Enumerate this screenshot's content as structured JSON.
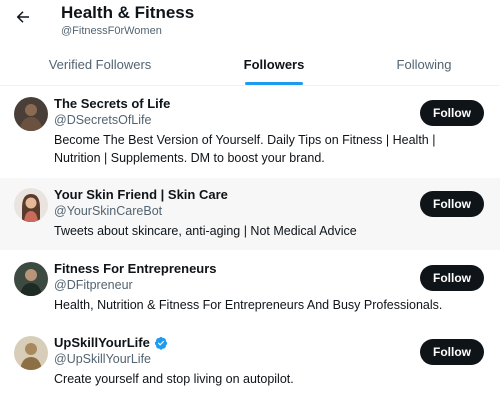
{
  "header": {
    "title": "Health & Fitness",
    "handle": "@FitnessF0rWomen"
  },
  "tabs": [
    {
      "label": "Verified Followers",
      "active": false
    },
    {
      "label": "Followers",
      "active": true
    },
    {
      "label": "Following",
      "active": false
    }
  ],
  "colors": {
    "accent": "#1d9bf0",
    "button_bg": "#0f1419",
    "secondary_text": "#536471"
  },
  "users": [
    {
      "name": "The Secrets of Life",
      "handle": "@DSecretsOfLife",
      "verified": false,
      "bio": "Become The Best Version of Yourself. Daily Tips on Fitness | Health | Nutrition | Supplements. DM to boost your brand.",
      "button": "Follow"
    },
    {
      "name": "Your Skin Friend | Skin Care",
      "handle": "@YourSkinCareBot",
      "verified": false,
      "bio": "Tweets about skincare, anti-aging | Not Medical Advice",
      "button": "Follow"
    },
    {
      "name": "Fitness For Entrepreneurs",
      "handle": "@DFitpreneur",
      "verified": false,
      "bio": "Health, Nutrition & Fitness For Entrepreneurs And Busy Professionals.",
      "button": "Follow"
    },
    {
      "name": "UpSkillYourLife",
      "handle": "@UpSkillYourLife",
      "verified": true,
      "bio": "Create yourself and stop living on autopilot.",
      "button": "Follow"
    }
  ]
}
